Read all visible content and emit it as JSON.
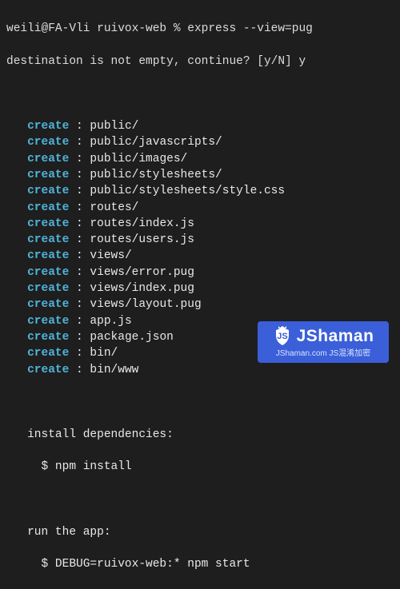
{
  "prompt": {
    "line1": "weili@FA-Vli ruivox-web % express --view=pug",
    "line2": "destination is not empty, continue? [y/N] y"
  },
  "create_keyword": "create",
  "entries": [
    "public/",
    "public/javascripts/",
    "public/images/",
    "public/stylesheets/",
    "public/stylesheets/style.css",
    "routes/",
    "routes/index.js",
    "routes/users.js",
    "views/",
    "views/error.pug",
    "views/index.pug",
    "views/layout.pug",
    "app.js",
    "package.json",
    "bin/",
    "bin/www"
  ],
  "instructions": {
    "install_header": "   install dependencies:",
    "install_cmd": "     $ npm install",
    "run_header": "   run the app:",
    "run_cmd": "     $ DEBUG=ruivox-web:* npm start"
  },
  "watermark": {
    "title": "JShaman",
    "subtitle": "JShaman.com JS混淆加密"
  }
}
